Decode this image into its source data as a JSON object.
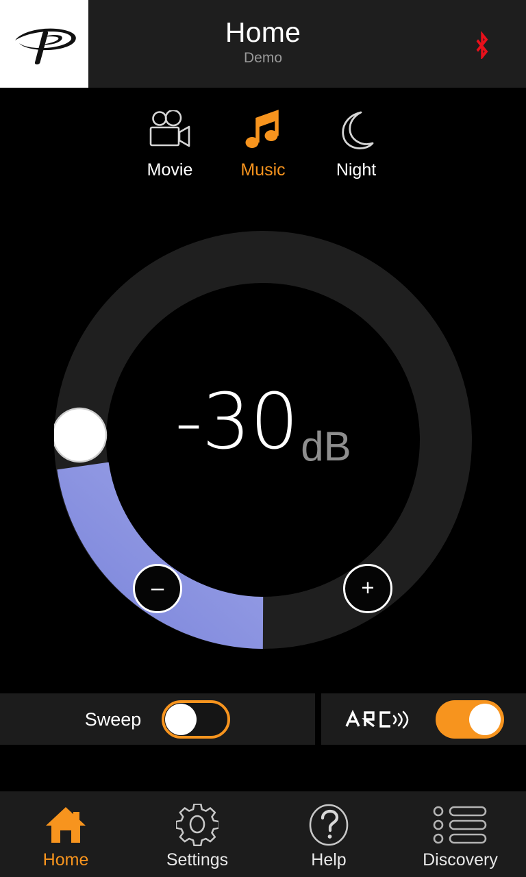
{
  "header": {
    "logo_icon": "paradigm-p-logo",
    "title": "Home",
    "subtitle": "Demo",
    "bluetooth_icon": "bluetooth-icon",
    "bluetooth_color": "#e8101b",
    "background": "#1e1e1e"
  },
  "colors": {
    "accent_orange": "#f7941e",
    "dial_arc": "#8b93dd",
    "dial_track": "#1f1f1f",
    "panel": "#1c1c1c",
    "background": "#000000",
    "text_primary": "#ffffff",
    "text_muted": "#8e8e8e"
  },
  "modes": [
    {
      "id": "movie",
      "label": "Movie",
      "icon": "movie-camera-icon",
      "active": false
    },
    {
      "id": "music",
      "label": "Music",
      "icon": "music-note-icon",
      "active": true
    },
    {
      "id": "night",
      "label": "Night",
      "icon": "crescent-moon-icon",
      "active": false
    }
  ],
  "volume": {
    "value": "-30",
    "unit": "dB",
    "decrease_label": "–",
    "increase_label": "+",
    "min": -80,
    "max": 0,
    "arc_fraction": 0.21
  },
  "toggles": [
    {
      "id": "sweep",
      "label": "Sweep",
      "state": "off",
      "state_label": "Off"
    },
    {
      "id": "arc",
      "label": "ARC",
      "icon": "arc-wordmark-icon",
      "state": "on",
      "state_label": "On"
    }
  ],
  "bottom_nav": [
    {
      "id": "home",
      "label": "Home",
      "icon": "house-icon",
      "active": true
    },
    {
      "id": "settings",
      "label": "Settings",
      "icon": "gear-icon",
      "active": false
    },
    {
      "id": "help",
      "label": "Help",
      "icon": "question-mark-circle-icon",
      "active": false
    },
    {
      "id": "discovery",
      "label": "Discovery",
      "icon": "list-icon",
      "active": false
    }
  ]
}
